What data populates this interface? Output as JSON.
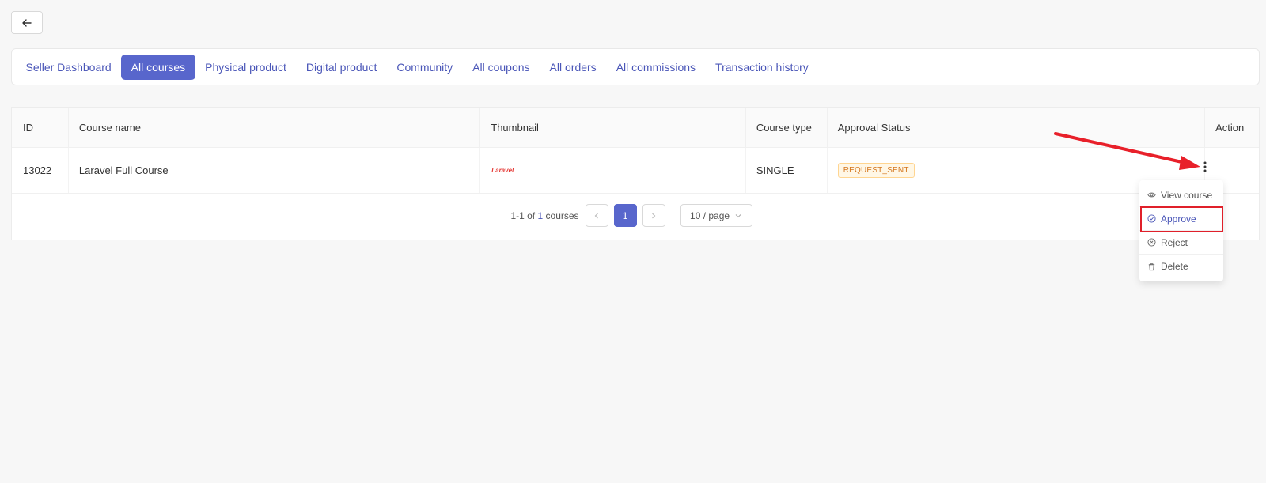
{
  "nav": {
    "tabs": [
      {
        "label": "Seller Dashboard",
        "active": false
      },
      {
        "label": "All courses",
        "active": true
      },
      {
        "label": "Physical product",
        "active": false
      },
      {
        "label": "Digital product",
        "active": false
      },
      {
        "label": "Community",
        "active": false
      },
      {
        "label": "All coupons",
        "active": false
      },
      {
        "label": "All orders",
        "active": false
      },
      {
        "label": "All commissions",
        "active": false
      },
      {
        "label": "Transaction history",
        "active": false
      }
    ]
  },
  "table": {
    "columns": [
      "ID",
      "Course name",
      "Thumbnail",
      "Course type",
      "Approval Status",
      "Action"
    ],
    "rows": [
      {
        "id": "13022",
        "name": "Laravel Full Course",
        "thumbnail_text": "Laravel",
        "type": "SINGLE",
        "status": "REQUEST_SENT"
      }
    ]
  },
  "pagination": {
    "range": "1-1 of",
    "total": "1",
    "unit": "courses",
    "current_page": "1",
    "page_size": "10 / page"
  },
  "action_menu": {
    "items": [
      {
        "label": "View course",
        "icon": "eye-icon"
      },
      {
        "label": "Approve",
        "icon": "check-circle-icon"
      },
      {
        "label": "Reject",
        "icon": "x-circle-icon"
      },
      {
        "label": "Delete",
        "icon": "trash-icon"
      }
    ]
  },
  "colors": {
    "accent": "#5866cc",
    "link": "#4a56b8",
    "status_badge": "#d4761d",
    "annotation": "#e0202a"
  }
}
